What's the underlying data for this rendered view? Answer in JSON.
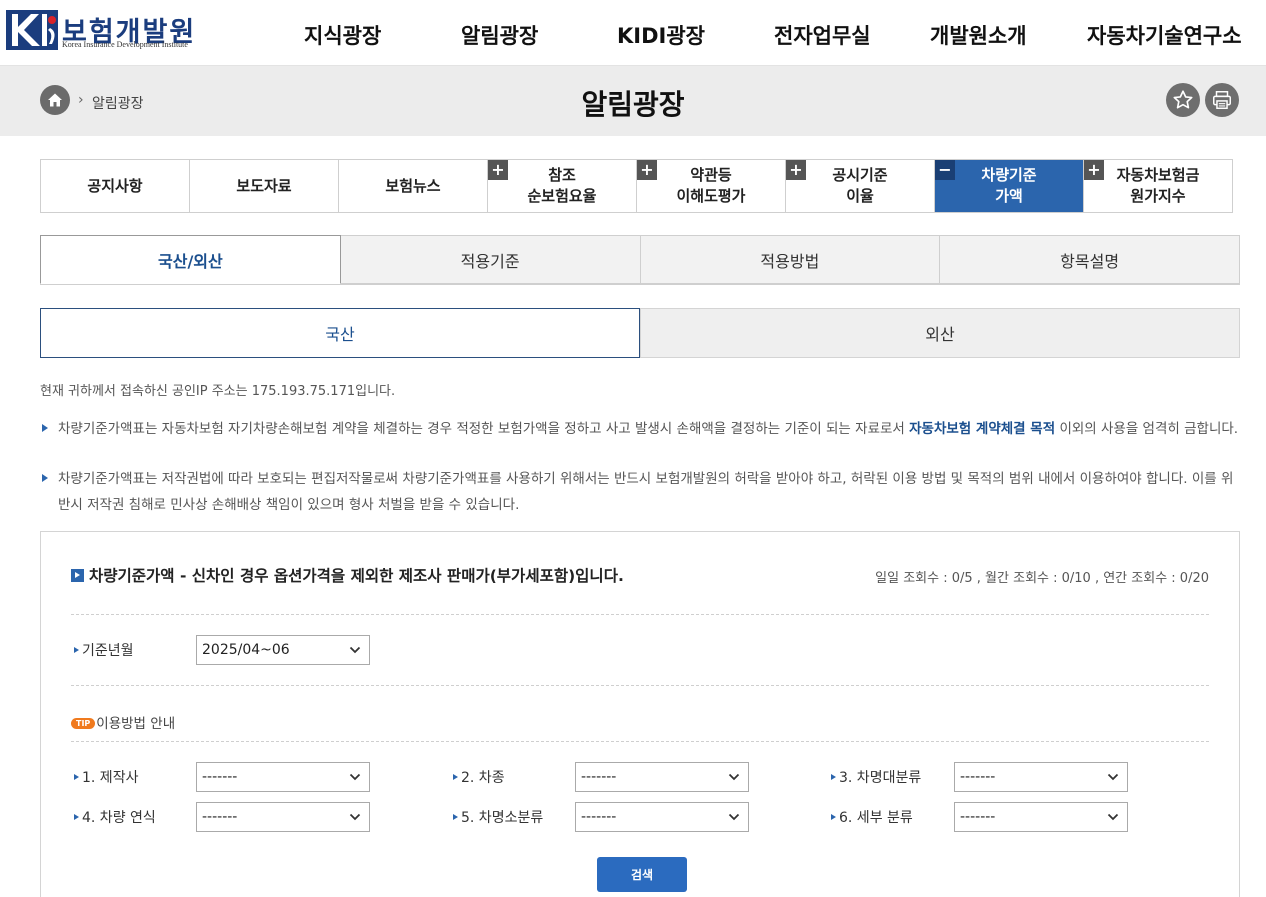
{
  "header": {
    "logo_name": "보험개발원",
    "logo_sub": "Korea Insurance Development Institute",
    "gnb": [
      "지식광장",
      "알림광장",
      "KIDI광장",
      "전자업무실",
      "개발원소개",
      "자동차기술연구소"
    ]
  },
  "band": {
    "crumb": "알림광장",
    "crumb_sep": "›",
    "title": "알림광장"
  },
  "subnav": [
    {
      "line1": "공지사항",
      "line2": "",
      "plus": ""
    },
    {
      "line1": "보도자료",
      "line2": "",
      "plus": ""
    },
    {
      "line1": "보험뉴스",
      "line2": "",
      "plus": ""
    },
    {
      "line1": "참조",
      "line2": "순보험요율",
      "plus": "+"
    },
    {
      "line1": "약관등",
      "line2": "이해도평가",
      "plus": "+"
    },
    {
      "line1": "공시기준",
      "line2": "이율",
      "plus": "+"
    },
    {
      "line1": "차량기준",
      "line2": "가액",
      "plus": "−"
    },
    {
      "line1": "자동차보험금",
      "line2": "원가지수",
      "plus": "+"
    }
  ],
  "tabs": [
    "국산/외산",
    "적용기준",
    "적용방법",
    "항목설명"
  ],
  "segment": [
    "국산",
    "외산"
  ],
  "ip_text": "현재 귀하께서 접속하신 공인IP 주소는 175.193.75.171입니다.",
  "notice1": {
    "pre": "차량기준가액표는 자동차보험 자기차량손해보험 계약을 체결하는 경우 적정한 보험가액을 정하고 사고 발생시 손해액을 결정하는 기준이 되는 자료로서 ",
    "highlight": "자동차보험 계약체결 목적",
    "post": " 이외의 사용을 엄격히 금합니다."
  },
  "notice2": "차량기준가액표는 저작권법에 따라 보호되는 편집저작물로써 차량기준가액표를 사용하기 위해서는 반드시 보험개발원의 허락을 받아야 하고, 허락된 이용 방법 및 목적의 범위 내에서 이용하여야 합니다. 이를 위반시 저작권 침해로 민사상 손해배상 책임이 있으며 형사 처벌을 받을 수 있습니다.",
  "box": {
    "title": "차량기준가액 - 신차인 경우 옵션가격을 제외한 제조사 판매가(부가세포함)입니다.",
    "counter": "일일 조회수 : 0/5 , 월간 조회수 : 0/10 , 연간 조회수 : 0/20",
    "base_label": "기준년월",
    "base_value": "2025/04~06",
    "tip_badge": "TIP",
    "tip_label": "이용방법 안내",
    "fields": [
      {
        "label": "1. 제작사",
        "value": "-------"
      },
      {
        "label": "2. 차종",
        "value": "-------"
      },
      {
        "label": "3. 차명대분류",
        "value": "-------"
      },
      {
        "label": "4. 차량 연식",
        "value": "-------"
      },
      {
        "label": "5. 차명소분류",
        "value": "-------"
      },
      {
        "label": "6. 세부 분류",
        "value": "-------"
      }
    ],
    "search_label": "검색"
  },
  "colors": {
    "accent": "#2b65ad",
    "tip": "#f07a1e",
    "band": "#ececec"
  },
  "icons": [
    "home-icon",
    "star-icon",
    "print-icon",
    "chevron-down-icon"
  ]
}
